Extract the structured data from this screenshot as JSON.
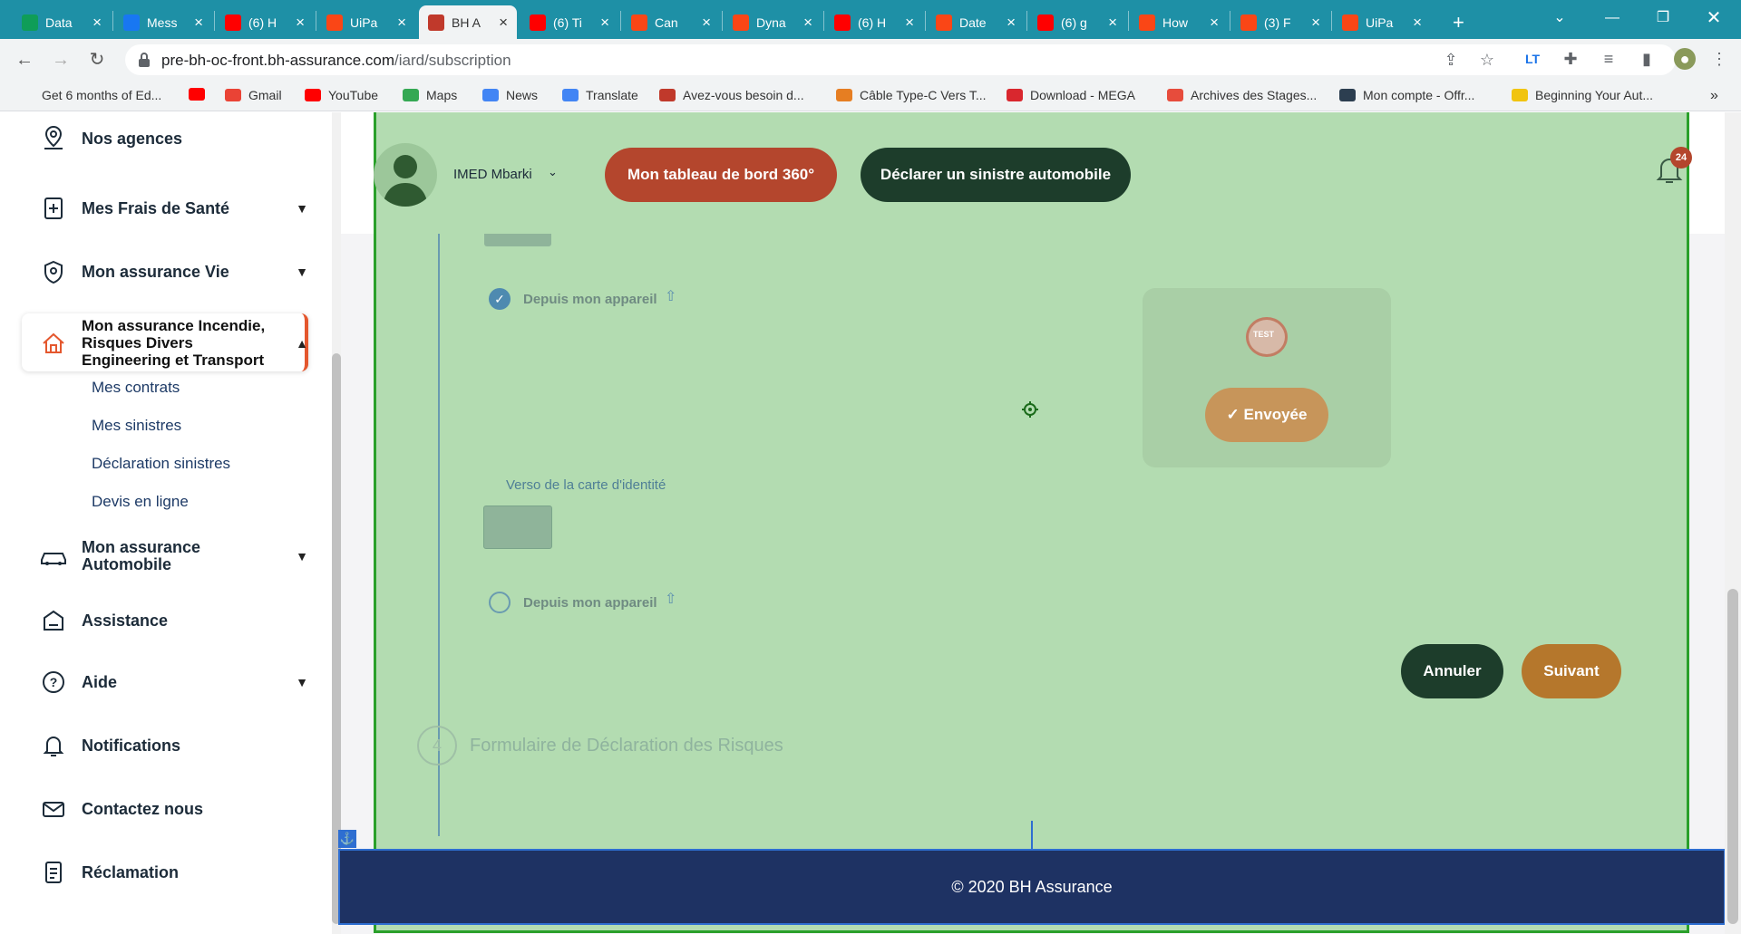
{
  "browser": {
    "tabs": [
      {
        "label": "Data",
        "icon": "sheets-icon",
        "color": "#0f9d58"
      },
      {
        "label": "Mess",
        "icon": "facebook-icon",
        "color": "#1877f2"
      },
      {
        "label": "(6) H",
        "icon": "youtube-icon",
        "color": "#ff0000"
      },
      {
        "label": "UiPa",
        "icon": "uipath-icon",
        "color": "#fa4616"
      },
      {
        "label": "BH A",
        "icon": "bh-icon",
        "color": "#c0392b",
        "active": true
      },
      {
        "label": "(6) Ti",
        "icon": "youtube-icon",
        "color": "#ff0000"
      },
      {
        "label": "Can",
        "icon": "uipath-icon",
        "color": "#fa4616"
      },
      {
        "label": "Dyna",
        "icon": "uipath-icon",
        "color": "#fa4616"
      },
      {
        "label": "(6) H",
        "icon": "youtube-icon",
        "color": "#ff0000"
      },
      {
        "label": "Date",
        "icon": "uipath-icon",
        "color": "#fa4616"
      },
      {
        "label": "(6) g",
        "icon": "youtube-icon",
        "color": "#ff0000"
      },
      {
        "label": "How",
        "icon": "uipath-icon",
        "color": "#fa4616"
      },
      {
        "label": "(3) F",
        "icon": "uipath-icon",
        "color": "#fa4616"
      },
      {
        "label": "UiPa",
        "icon": "uipath-icon",
        "color": "#fa4616"
      }
    ],
    "new_tab": "+",
    "url_host": "pre-bh-oc-front.bh-assurance.com",
    "url_path": "/iard/subscription",
    "bookmarks": [
      {
        "label": "Get 6 months of Ed...",
        "icon": "bookmark-icon",
        "color": "#ffffff"
      },
      {
        "label": "",
        "icon": "youtube-icon",
        "color": "#ff0000"
      },
      {
        "label": "Gmail",
        "icon": "gmail-icon",
        "color": "#ea4335"
      },
      {
        "label": "YouTube",
        "icon": "youtube-icon",
        "color": "#ff0000"
      },
      {
        "label": "Maps",
        "icon": "maps-icon",
        "color": "#34a853"
      },
      {
        "label": "News",
        "icon": "news-icon",
        "color": "#4285f4"
      },
      {
        "label": "Translate",
        "icon": "translate-icon",
        "color": "#4285f4"
      },
      {
        "label": "Avez-vous besoin d...",
        "icon": "book-icon",
        "color": "#c0392b"
      },
      {
        "label": "Câble Type-C Vers T...",
        "icon": "cart-icon",
        "color": "#e67e22"
      },
      {
        "label": "Download - MEGA",
        "icon": "mega-icon",
        "color": "#d9272e"
      },
      {
        "label": "Archives des Stages...",
        "icon": "search-icon",
        "color": "#e74c3c"
      },
      {
        "label": "Mon compte - Offr...",
        "icon": "oe-icon",
        "color": "#2c3e50"
      },
      {
        "label": "Beginning Your Aut...",
        "icon": "a-icon",
        "color": "#f1c40f"
      }
    ],
    "more_bookmarks": "»"
  },
  "sidebar": {
    "items": [
      {
        "label": "Nos agences",
        "icon": "location-pin-icon"
      },
      {
        "label": "Mes Frais de Santé",
        "icon": "health-icon"
      },
      {
        "label": "Mon assurance Vie",
        "icon": "life-insurance-icon"
      },
      {
        "label": "Mon assurance Incendie, Risques Divers Engineering et Transport",
        "icon": "house-icon"
      },
      {
        "label": "Mon assurance Automobile",
        "icon": "car-icon"
      },
      {
        "label": "Assistance",
        "icon": "assistance-icon"
      },
      {
        "label": "Aide",
        "icon": "help-icon"
      },
      {
        "label": "Notifications",
        "icon": "bell-icon"
      },
      {
        "label": "Contactez nous",
        "icon": "mail-icon"
      },
      {
        "label": "Réclamation",
        "icon": "complaint-icon"
      }
    ],
    "subitems": [
      "Mes contrats",
      "Mes sinistres",
      "Déclaration sinistres",
      "Devis en ligne"
    ]
  },
  "header": {
    "user_name": "IMED Mbarki",
    "dashboard_button": "Mon tableau de bord 360°",
    "declare_button": "Déclarer un sinistre automobile",
    "notification_count": "24"
  },
  "form": {
    "upload_recto_label": "Depuis mon appareil",
    "upload_verso_label": "Depuis mon appareil",
    "verso_title": "Verso de la carte d'identité",
    "preview_badge": "TEST",
    "sent_button": "✓ Envoyée",
    "cancel_button": "Annuler",
    "next_button": "Suivant",
    "step_number": "4",
    "step_title": "Formulaire de Déclaration des Risques"
  },
  "footer": {
    "copyright": "© 2020 BH Assurance"
  },
  "colors": {
    "tabbar": "#1e90a6",
    "overlay": "#b3dcb1",
    "dashboard_button": "#b4462d",
    "declare_button": "#1d3d2b",
    "cancel_button": "#1d3d2b",
    "next_button": "#b5772c",
    "sent_button": "#c7955a",
    "footer": "#1e3263",
    "active_accent": "#e4572e"
  }
}
